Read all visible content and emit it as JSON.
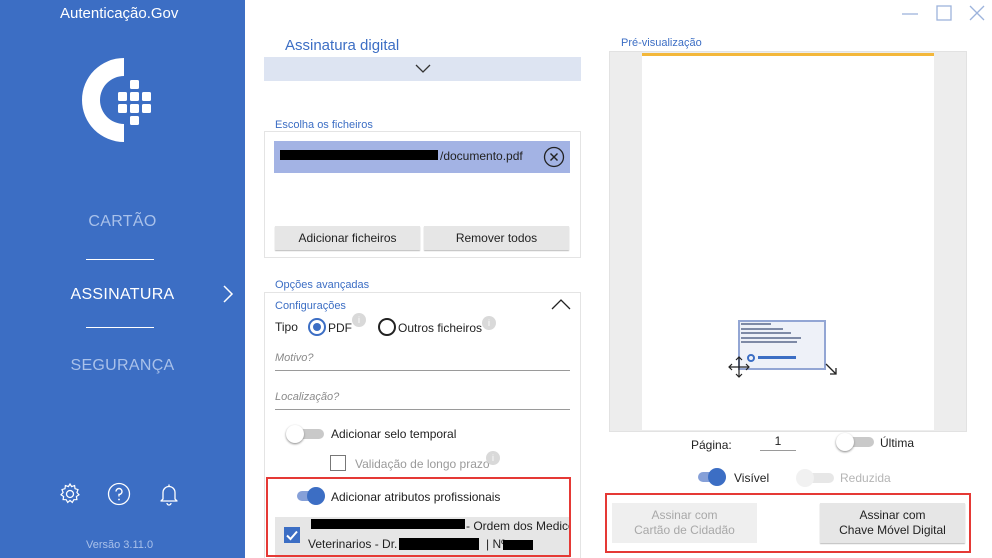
{
  "app": {
    "title": "Autenticação.Gov",
    "version": "Versão 3.11.0"
  },
  "sidebar": {
    "items": [
      {
        "label": "CARTÃO"
      },
      {
        "label": "ASSINATURA"
      },
      {
        "label": "SEGURANÇA"
      }
    ]
  },
  "main": {
    "section_title": "Assinatura digital",
    "files": {
      "label": "Escolha os ficheiros",
      "file_suffix": "/documento.pdf",
      "add_button": "Adicionar ficheiros",
      "remove_button": "Remover todos"
    },
    "advanced": {
      "label": "Opções avançadas",
      "config_label": "Configurações",
      "tipo_label": "Tipo",
      "option_pdf": "PDF",
      "option_other": "Outros ficheiros",
      "info_glyph": "i",
      "motivo_placeholder": "Motivo?",
      "localizacao_placeholder": "Localização?",
      "timestamp_label": "Adicionar selo temporal",
      "long_term_label": "Validação de longo prazo",
      "prof_attr_label": "Adicionar atributos profissionais",
      "prof_line1_suffix": "- Ordem dos Medicos",
      "prof_line2_prefix": "Veterinarios - Dr.",
      "prof_line2_suffix": "| Nº"
    }
  },
  "preview": {
    "label": "Pré-visualização",
    "page_label": "Página:",
    "page_value": "1",
    "last_label": "Última",
    "visible_label": "Visível",
    "reduced_label": "Reduzida"
  },
  "buttons": {
    "sign_cc": "Assinar com\nCartão de Cidadão",
    "sign_cmd": "Assinar com\nChave Móvel Digital"
  },
  "colors": {
    "primary": "#3c6ec4",
    "sidebar": "#3c6ec4",
    "highlight": "#e53935",
    "file_row": "#a3b3e4"
  },
  "state": {
    "timestamp_toggle": false,
    "prof_attr_toggle": true,
    "visible_toggle": true,
    "reduced_toggle": false,
    "last_page_toggle": false,
    "long_term_checked": false,
    "prof_checked": true,
    "type_selected": "PDF"
  }
}
